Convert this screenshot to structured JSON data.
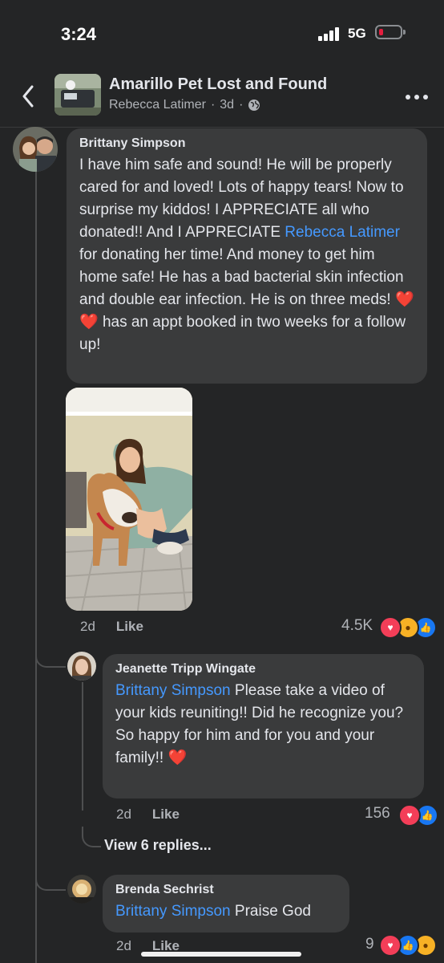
{
  "status_bar": {
    "time": "3:24",
    "network": "5G"
  },
  "header": {
    "group_name": "Amarillo Pet Lost and Found",
    "poster": "Rebecca Latimer",
    "age": "3d"
  },
  "comments": [
    {
      "author": "Brittany Simpson",
      "text_parts": {
        "part1": "I have him safe and sound! He will be properly cared for and loved! Lots of happy tears! Now to surprise my kiddos! I APPRECIATE all who donated!! And I APPRECIATE ",
        "mention": "Rebecca Latimer",
        "part2": " for donating her time! And money to get him home safe! He has a bad bacterial skin infection and double ear infection. He is on three meds! ",
        "emoji": "❤️ ❤️",
        "part3": " has an appt booked in two weeks for a follow up!"
      },
      "age": "2d",
      "like_label": "Like",
      "reaction_count": "4.5K"
    },
    {
      "author": "Jeanette Tripp Wingate",
      "mention": "Brittany Simpson",
      "text": " Please take a video of your kids reuniting!!  Did he recognize you?",
      "text2": "So happy for him and for you and your family!! ",
      "emoji": "❤️",
      "age": "2d",
      "like_label": "Like",
      "reaction_count": "156"
    },
    {
      "author": "Brenda Sechrist",
      "mention": "Brittany Simpson",
      "text": " Praise God",
      "age": "2d",
      "like_label": "Like",
      "reaction_count": "9"
    }
  ],
  "view_replies": "View 6 replies...",
  "colors": {
    "background": "#242526",
    "bubble": "#3a3b3c",
    "mention": "#4599ff",
    "love": "#f33e58",
    "like": "#1877f2",
    "care": "#f7b125"
  }
}
